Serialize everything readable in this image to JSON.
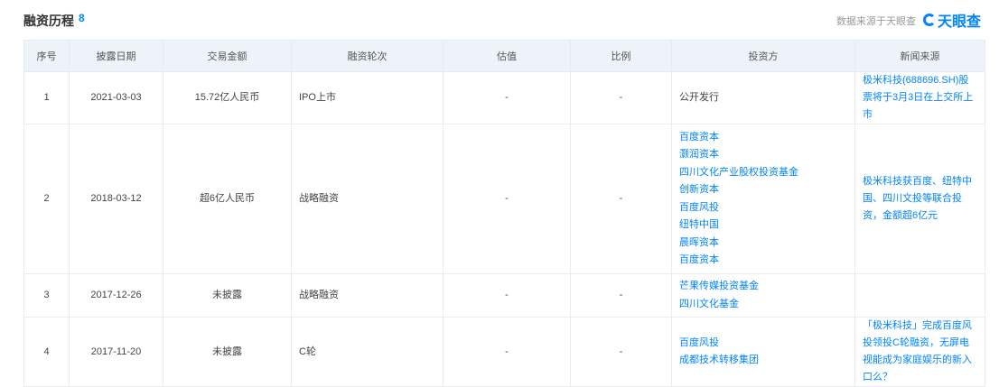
{
  "header": {
    "title": "融资历程",
    "count": "8",
    "source_note": "数据来源于天眼查",
    "logo_text": "天眼查"
  },
  "table": {
    "columns": [
      "序号",
      "披露日期",
      "交易金额",
      "融资轮次",
      "估值",
      "比例",
      "投资方",
      "新闻来源"
    ],
    "rows": [
      {
        "index": "1",
        "date": "2021-03-03",
        "amount": "15.72亿人民币",
        "round": "IPO上市",
        "valuation": "-",
        "ratio": "-",
        "investors": [
          "公开发行"
        ],
        "investors_linked": false,
        "news": "极米科技(688696.SH)股票将于3月3日在上交所上市"
      },
      {
        "index": "2",
        "date": "2018-03-12",
        "amount": "超6亿人民币",
        "round": "战略融资",
        "valuation": "-",
        "ratio": "-",
        "investors": [
          "百度资本",
          "灏润资本",
          "四川文化产业股权投资基金",
          "创新资本",
          "百度风投",
          "纽特中国",
          "晨晖资本",
          "百度资本"
        ],
        "investors_linked": true,
        "news": "极米科技获百度、纽特中国、四川文投等联合投资，金额超6亿元"
      },
      {
        "index": "3",
        "date": "2017-12-26",
        "amount": "未披露",
        "round": "战略融资",
        "valuation": "-",
        "ratio": "-",
        "investors": [
          "芒果传媒投资基金",
          "四川文化基金"
        ],
        "investors_linked": true,
        "news": ""
      },
      {
        "index": "4",
        "date": "2017-11-20",
        "amount": "未披露",
        "round": "C轮",
        "valuation": "-",
        "ratio": "-",
        "investors": [
          "百度风投",
          "成都技术转移集团"
        ],
        "investors_linked": true,
        "news": "「极米科技」完成百度风投领投C轮融资，无屏电视能成为家庭娱乐的新入口么？"
      }
    ]
  }
}
